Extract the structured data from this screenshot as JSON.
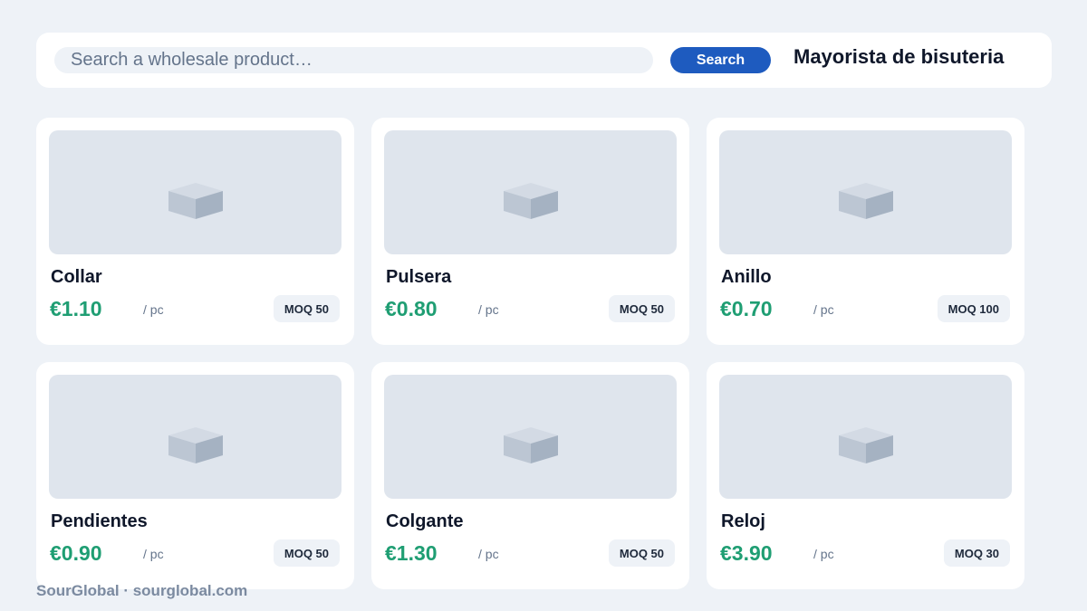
{
  "header": {
    "search_placeholder": "Search a wholesale product…",
    "search_button": "Search",
    "title": "Mayorista de bisuteria"
  },
  "products": [
    {
      "name": "Collar",
      "price": "€1.10",
      "unit": "/ pc",
      "moq": "MOQ 50",
      "image_icon": "box-icon"
    },
    {
      "name": "Pulsera",
      "price": "€0.80",
      "unit": "/ pc",
      "moq": "MOQ 50",
      "image_icon": "box-icon"
    },
    {
      "name": "Anillo",
      "price": "€0.70",
      "unit": "/ pc",
      "moq": "MOQ 100",
      "image_icon": "box-icon"
    },
    {
      "name": "Pendientes",
      "price": "€0.90",
      "unit": "/ pc",
      "moq": "MOQ 50",
      "image_icon": "box-icon"
    },
    {
      "name": "Colgante",
      "price": "€1.30",
      "unit": "/ pc",
      "moq": "MOQ 50",
      "image_icon": "box-icon"
    },
    {
      "name": "Reloj",
      "price": "€3.90",
      "unit": "/ pc",
      "moq": "MOQ 30",
      "image_icon": "box-icon"
    }
  ],
  "footer": {
    "text": "SourGlobal · sourglobal.com"
  },
  "colors": {
    "background": "#eef2f7",
    "accent": "#1e5bbf",
    "price": "#1f9e73",
    "placeholder_image": "#dfe5ed"
  }
}
